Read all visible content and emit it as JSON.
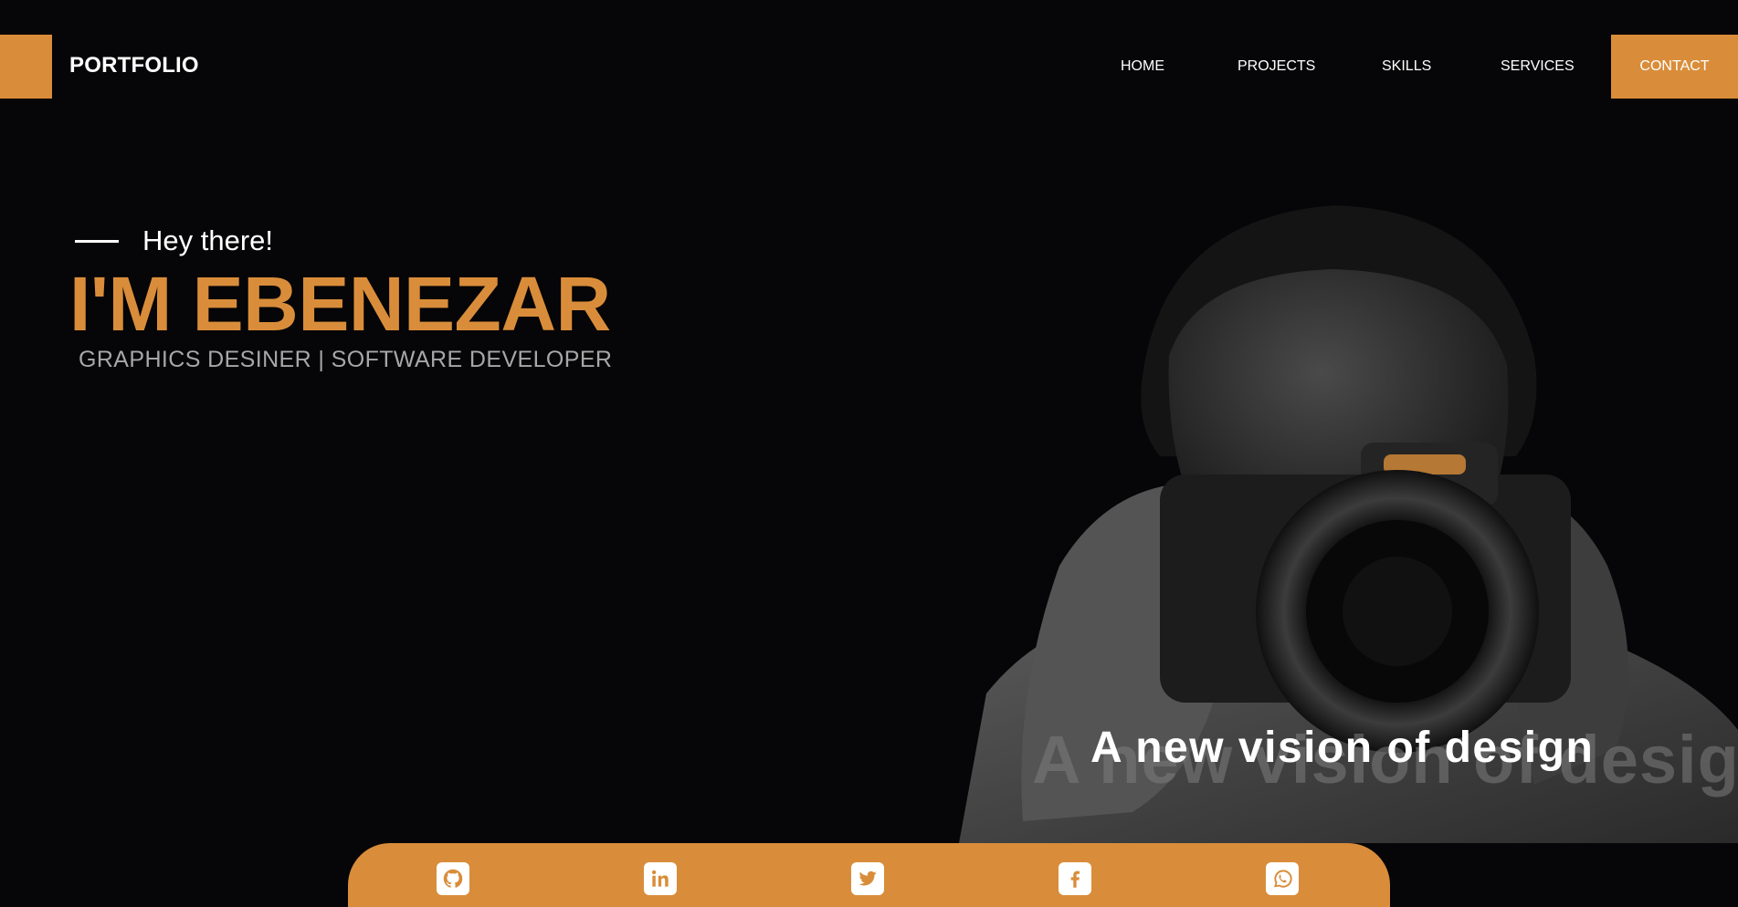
{
  "header": {
    "brand": "PORTFOLIO",
    "nav": {
      "home": "HOME",
      "projects": "PROJECTS",
      "skills": "SKILLS",
      "services": "SERVICES",
      "contact": "CONTACT"
    }
  },
  "hero": {
    "greeting": "Hey there!",
    "name": "I'M EBENEZAR",
    "role": "GRAPHICS DESINER | SOFTWARE DEVELOPER",
    "tagline": "A new vision of design",
    "tagline_ghost": "A new vision of design"
  },
  "social_links": [
    {
      "icon": "github-icon"
    },
    {
      "icon": "linkedin-icon"
    },
    {
      "icon": "twitter-icon"
    },
    {
      "icon": "facebook-icon"
    },
    {
      "icon": "whatsapp-icon"
    }
  ],
  "colors": {
    "background": "#060507",
    "accent": "#d98d3a",
    "text": "#ffffff",
    "muted_text": "#a7a7a7"
  }
}
